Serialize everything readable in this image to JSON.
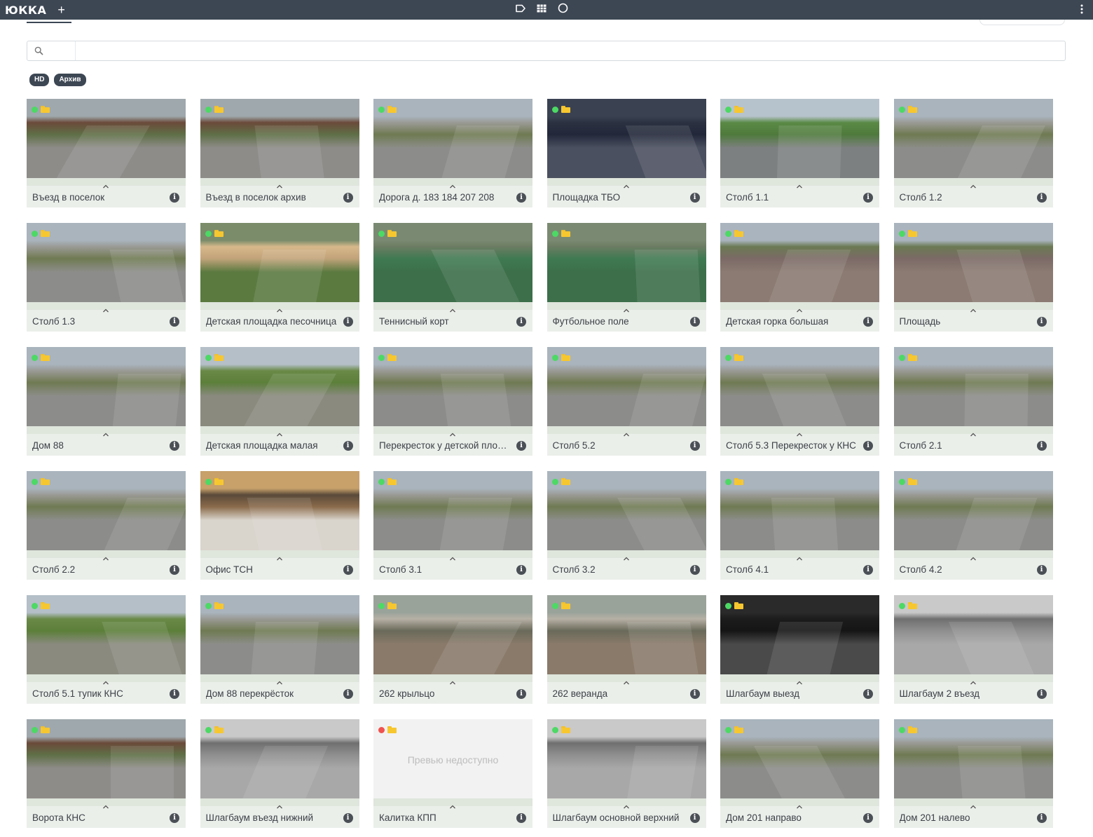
{
  "app": {
    "logo": "ЮККА",
    "add": "+"
  },
  "search": {
    "value": "",
    "placeholder": ""
  },
  "filters": [
    "HD",
    "Архив"
  ],
  "colors": {
    "topbar": "#3d4754",
    "online": "#4cd964",
    "offline": "#f0524f",
    "archive": "#f7c730"
  },
  "cameras": [
    {
      "name": "Въезд в поселок",
      "status": "online",
      "scene": "gate"
    },
    {
      "name": "Въезд в поселок архив",
      "status": "online",
      "scene": "gate"
    },
    {
      "name": "Дорога д. 183 184 207 208",
      "status": "online",
      "scene": "road"
    },
    {
      "name": "Площадка ТБО",
      "status": "online",
      "scene": "dark"
    },
    {
      "name": "Столб 1.1",
      "status": "online",
      "scene": "long"
    },
    {
      "name": "Столб 1.2",
      "status": "online",
      "scene": "road"
    },
    {
      "name": "Столб 1.3",
      "status": "online",
      "scene": "road"
    },
    {
      "name": "Детская площадка песочница",
      "status": "online",
      "scene": "play"
    },
    {
      "name": "Теннисный корт",
      "status": "online",
      "scene": "court"
    },
    {
      "name": "Футбольное поле",
      "status": "online",
      "scene": "court"
    },
    {
      "name": "Детская горка большая",
      "status": "online",
      "scene": "plaza"
    },
    {
      "name": "Площадь",
      "status": "online",
      "scene": "plaza"
    },
    {
      "name": "Дом 88",
      "status": "online",
      "scene": "road"
    },
    {
      "name": "Детская площадка малая",
      "status": "online",
      "scene": "grass"
    },
    {
      "name": "Перекресток у детской площадки",
      "status": "online",
      "scene": "road"
    },
    {
      "name": "Столб 5.2",
      "status": "online",
      "scene": "road"
    },
    {
      "name": "Столб 5.3 Перекресток у КНС",
      "status": "online",
      "scene": "road"
    },
    {
      "name": "Столб 2.1",
      "status": "online",
      "scene": "road"
    },
    {
      "name": "Столб 2.2",
      "status": "online",
      "scene": "road"
    },
    {
      "name": "Офис ТСН",
      "status": "online",
      "scene": "office"
    },
    {
      "name": "Столб 3.1",
      "status": "online",
      "scene": "road"
    },
    {
      "name": "Столб 3.2",
      "status": "online",
      "scene": "road"
    },
    {
      "name": "Столб 4.1",
      "status": "online",
      "scene": "road"
    },
    {
      "name": "Столб 4.2",
      "status": "online",
      "scene": "road"
    },
    {
      "name": "Столб 5.1 тупик КНС",
      "status": "online",
      "scene": "grass"
    },
    {
      "name": "Дом 88 перекрёсток",
      "status": "online",
      "scene": "road"
    },
    {
      "name": "262 крыльцо",
      "status": "online",
      "scene": "porch"
    },
    {
      "name": "262 веранда",
      "status": "online",
      "scene": "porch"
    },
    {
      "name": "Шлагбаум выезд",
      "status": "online",
      "scene": "night"
    },
    {
      "name": "Шлагбаум 2 въезд",
      "status": "online",
      "scene": "gray"
    },
    {
      "name": "Ворота КНС",
      "status": "online",
      "scene": "gate"
    },
    {
      "name": "Шлагбаум въезд нижний",
      "status": "online",
      "scene": "gray"
    },
    {
      "name": "Калитка КПП",
      "status": "offline",
      "scene": "none",
      "preview_text": "Превью недоступно"
    },
    {
      "name": "Шлагбаум основной верхний",
      "status": "online",
      "scene": "gray"
    },
    {
      "name": "Дом 201 направо",
      "status": "online",
      "scene": "road"
    },
    {
      "name": "Дом 201 налево",
      "status": "online",
      "scene": "road"
    }
  ]
}
